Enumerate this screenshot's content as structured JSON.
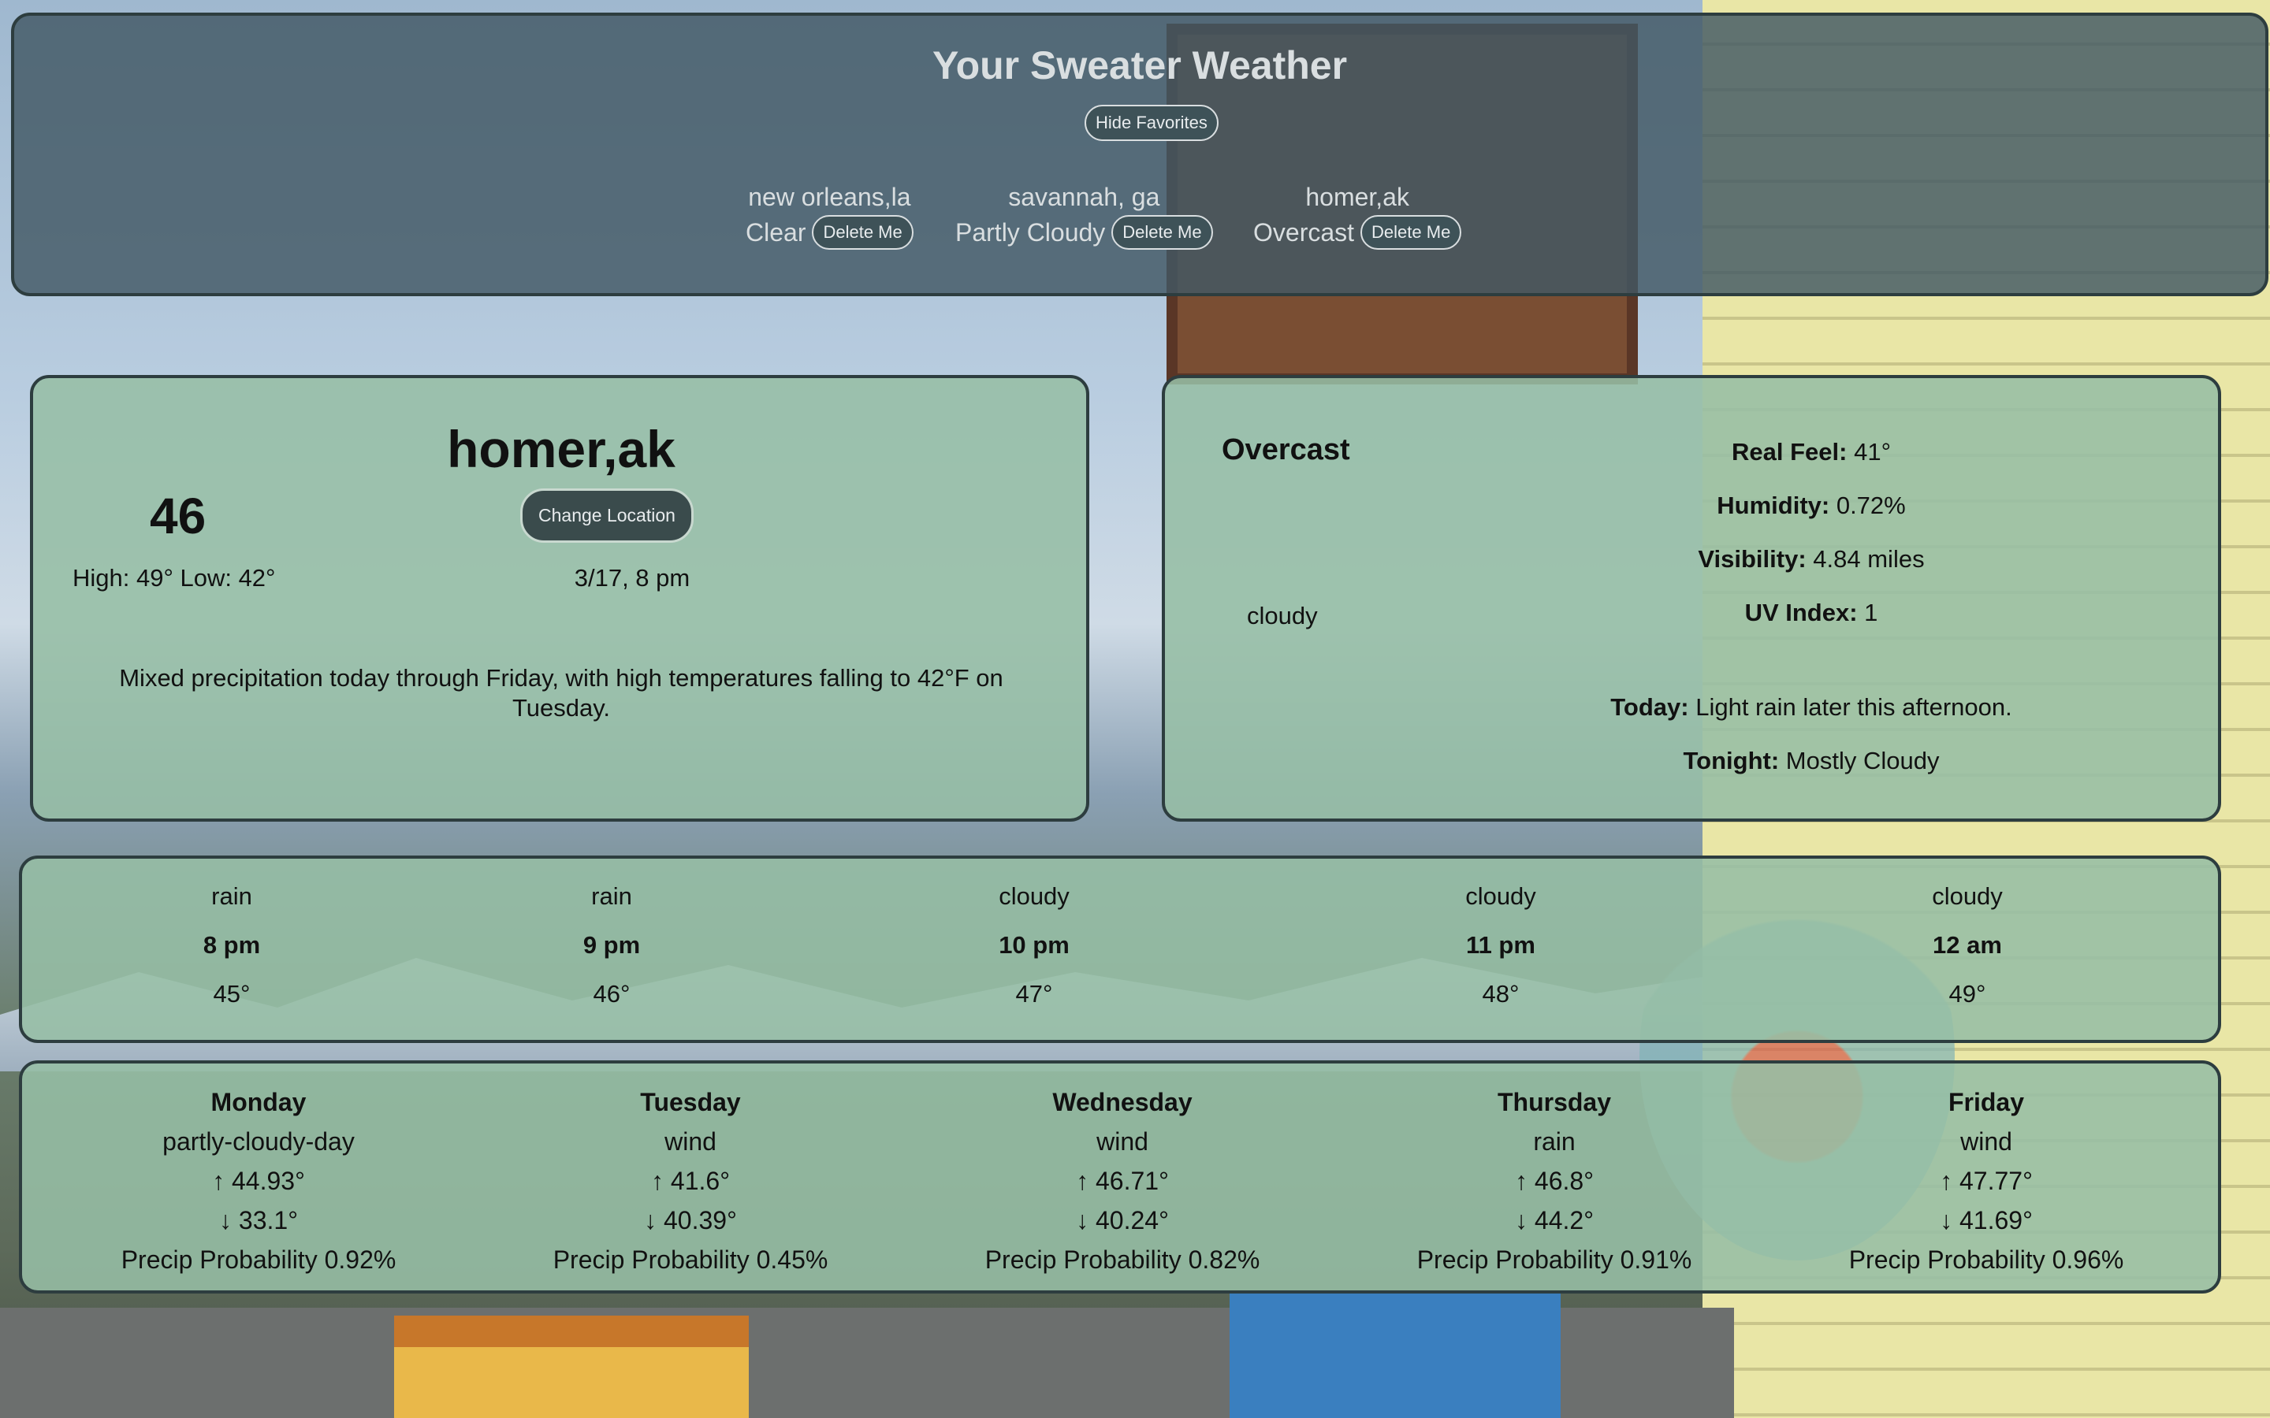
{
  "header": {
    "title": "Your Sweater Weather",
    "hide_favorites_label": "Hide Favorites",
    "favorites": [
      {
        "city": "new orleans,la",
        "condition": "Clear",
        "delete_label": "Delete Me"
      },
      {
        "city": "savannah, ga",
        "condition": "Partly Cloudy",
        "delete_label": "Delete Me"
      },
      {
        "city": "homer,ak",
        "condition": "Overcast",
        "delete_label": "Delete Me"
      }
    ]
  },
  "current": {
    "city": "homer,ak",
    "temperature": "46",
    "change_location_label": "Change Location",
    "high_low": "High: 49° Low: 42°",
    "datetime": "3/17, 8 pm",
    "summary": "Mixed precipitation today through Friday, with high temperatures falling to 42°F on Tuesday."
  },
  "details": {
    "condition": "Overcast",
    "icon_text": "cloudy",
    "real_feel_label": "Real Feel:",
    "real_feel_value": "41°",
    "humidity_label": "Humidity:",
    "humidity_value": "0.72%",
    "visibility_label": "Visibility:",
    "visibility_value": "4.84 miles",
    "uv_label": "UV Index:",
    "uv_value": "1",
    "today_label": "Today:",
    "today_value": "Light rain later this afternoon.",
    "tonight_label": "Tonight:",
    "tonight_value": "Mostly Cloudy"
  },
  "hourly": [
    {
      "icon": "rain",
      "time": "8 pm",
      "temp": "45°"
    },
    {
      "icon": "rain",
      "time": "9 pm",
      "temp": "46°"
    },
    {
      "icon": "cloudy",
      "time": "10 pm",
      "temp": "47°"
    },
    {
      "icon": "cloudy",
      "time": "11 pm",
      "temp": "48°"
    },
    {
      "icon": "cloudy",
      "time": "12 am",
      "temp": "49°"
    }
  ],
  "daily": [
    {
      "day": "Monday",
      "icon": "partly-cloudy-day",
      "high": "↑ 44.93°",
      "low": "↓ 33.1°",
      "precip": "Precip Probability 0.92%"
    },
    {
      "day": "Tuesday",
      "icon": "wind",
      "high": "↑ 41.6°",
      "low": "↓ 40.39°",
      "precip": "Precip Probability 0.45%"
    },
    {
      "day": "Wednesday",
      "icon": "wind",
      "high": "↑ 46.71°",
      "low": "↓ 40.24°",
      "precip": "Precip Probability 0.82%"
    },
    {
      "day": "Thursday",
      "icon": "rain",
      "high": "↑ 46.8°",
      "low": "↓ 44.2°",
      "precip": "Precip Probability 0.91%"
    },
    {
      "day": "Friday",
      "icon": "wind",
      "high": "↑ 47.77°",
      "low": "↓ 41.69°",
      "precip": "Precip Probability 0.96%"
    }
  ]
}
